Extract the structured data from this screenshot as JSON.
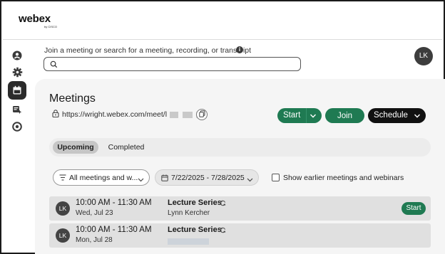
{
  "brand": {
    "name": "webex",
    "sub": "by CISCO"
  },
  "search": {
    "hint": "Join a meeting or search for a meeting, recording, or transcript",
    "info_glyph": "i",
    "value": "",
    "placeholder": ""
  },
  "user": {
    "initials": "LK"
  },
  "rail": {
    "items": [
      {
        "name": "profile-icon"
      },
      {
        "name": "settings-icon"
      },
      {
        "name": "calendar-icon",
        "active": true
      },
      {
        "name": "transcript-ai-icon"
      },
      {
        "name": "circle-icon"
      }
    ]
  },
  "meetings": {
    "title": "Meetings",
    "url": "https://wright.webex.com/meet/l",
    "actions": {
      "start": "Start",
      "join": "Join",
      "schedule": "Schedule"
    },
    "tabs": [
      {
        "label": "Upcoming",
        "active": true
      },
      {
        "label": "Completed",
        "active": false
      }
    ],
    "filters": {
      "meeting_type": "All meetings and w...",
      "date_range": "7/22/2025 - 7/28/2025",
      "show_earlier": "Show earlier meetings and webinars",
      "show_earlier_checked": false
    },
    "list": [
      {
        "initials": "LK",
        "time": "10:00 AM - 11:30 AM",
        "day": "Wed, Jul 23",
        "title": "Lecture Series",
        "host": "Lynn Kercher",
        "action": "Start"
      },
      {
        "initials": "LK",
        "time": "10:00 AM - 11:30 AM",
        "day": "Mon, Jul 28",
        "title": "Lecture Series",
        "host": ""
      }
    ]
  },
  "colors": {
    "primary_green": "#1f7a52",
    "dark": "#111111",
    "active_rail": "#2b2b2b"
  }
}
